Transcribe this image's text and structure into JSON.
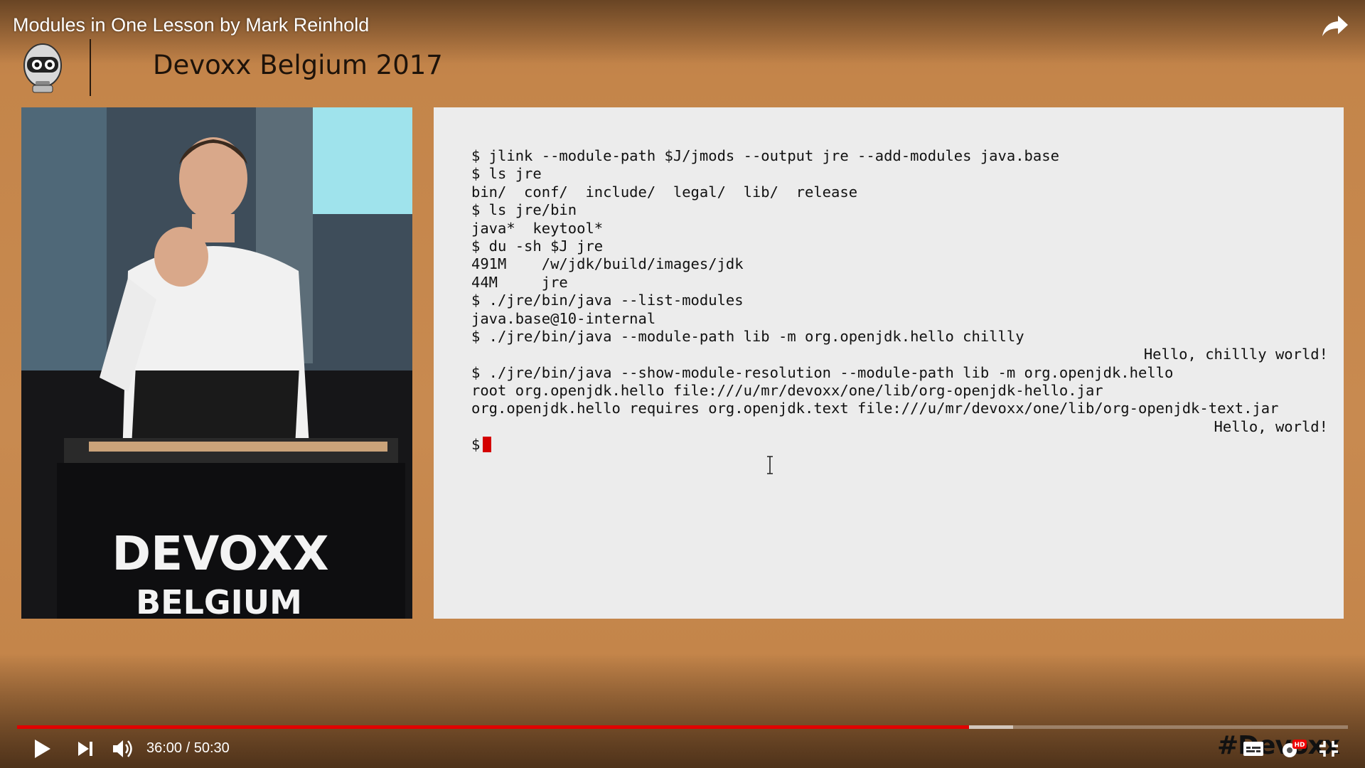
{
  "player": {
    "title": "Modules in One Lesson by Mark Reinhold",
    "time_current": "36:00",
    "time_separator": " / ",
    "time_total": "50:30",
    "progress_played": 0.7154,
    "progress_buffered": 0.7485,
    "accent_color": "#e00000",
    "controls": [
      "play-icon",
      "next-icon",
      "volume-icon",
      "subtitles-icon",
      "settings-icon",
      "hd-badge",
      "exit-fullscreen-icon",
      "share-icon"
    ],
    "hd_label": "HD"
  },
  "conference": {
    "title": "Devoxx Belgium 2017",
    "podium_line1": "DEVOXX",
    "podium_line2": "BELGIUM",
    "watermark": "#Devoxx"
  },
  "terminal": {
    "lines": [
      {
        "text": "$ jlink --module-path $J/jmods --output jre --add-modules java.base",
        "align": "left"
      },
      {
        "text": "$ ls jre",
        "align": "left"
      },
      {
        "text": "bin/  conf/  include/  legal/  lib/  release",
        "align": "left"
      },
      {
        "text": "$ ls jre/bin",
        "align": "left"
      },
      {
        "text": "java*  keytool*",
        "align": "left"
      },
      {
        "text": "$ du -sh $J jre",
        "align": "left"
      },
      {
        "text": "491M    /w/jdk/build/images/jdk",
        "align": "left"
      },
      {
        "text": "44M     jre",
        "align": "left"
      },
      {
        "text": "$ ./jre/bin/java --list-modules",
        "align": "left"
      },
      {
        "text": "java.base@10-internal",
        "align": "left"
      },
      {
        "text": "$ ./jre/bin/java --module-path lib -m org.openjdk.hello chillly",
        "align": "left"
      },
      {
        "text": "Hello, chillly world!",
        "align": "right"
      },
      {
        "text": "$ ./jre/bin/java --show-module-resolution --module-path lib -m org.openjdk.hello",
        "align": "left"
      },
      {
        "text": "root org.openjdk.hello file:///u/mr/devoxx/one/lib/org-openjdk-hello.jar",
        "align": "left"
      },
      {
        "text": "org.openjdk.hello requires org.openjdk.text file:///u/mr/devoxx/one/lib/org-openjdk-text.jar",
        "align": "left"
      },
      {
        "text": "Hello, world!",
        "align": "right"
      }
    ],
    "prompt": "$",
    "cursor_color": "#d40000"
  }
}
